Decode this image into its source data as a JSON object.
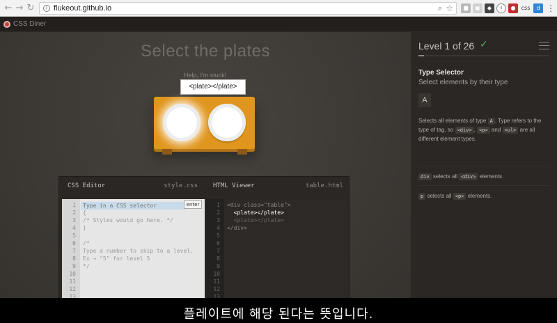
{
  "browser": {
    "url": "flukeout.github.io",
    "extensions": [
      "css"
    ]
  },
  "app": {
    "name": "CSS Diner"
  },
  "game": {
    "order": "Select the plates",
    "help": "Help, I'm stuck!",
    "tooltip": "<plate></plate>"
  },
  "editor": {
    "css_title": "CSS Editor",
    "css_file": "style.css",
    "placeholder": "Type in a CSS selector",
    "enter_label": "enter",
    "css_lines": [
      "{",
      "/* Styles would go here. */",
      "}",
      "",
      "/*",
      "Type a number to skip to a level.",
      "Ex → \"5\" for level 5",
      "*/"
    ],
    "html_title": "HTML Viewer",
    "html_file": "table.html",
    "html_lines": [
      "<div class=\"table\">",
      "  <plate></plate>",
      "  <plate></plate>",
      "</div>"
    ],
    "line_numbers": [
      "1",
      "2",
      "3",
      "4",
      "5",
      "6",
      "7",
      "8",
      "9",
      "10",
      "11",
      "12",
      "13"
    ]
  },
  "sidebar": {
    "level": "Level 1 of 26",
    "progress": 0.04,
    "selector_name": "Type Selector",
    "selector_title": "Select elements by their type",
    "syntax": "A",
    "hint_1": "Selects all elements of type",
    "hint_2": ". Type refers to the type of tag, so",
    "hint_3": "and",
    "hint_4": "are all different element types.",
    "hint_tags": [
      "A",
      "<div>",
      "<p>",
      "<ul>"
    ],
    "examples": [
      {
        "code": "div",
        "text": "selects all",
        "tag": "<div>",
        "suffix": "elements."
      },
      {
        "code": "p",
        "text": "selects all",
        "tag": "<p>",
        "suffix": "elements."
      }
    ]
  },
  "subtitle": "플레이트에 해당 된다는 뜻입니다."
}
